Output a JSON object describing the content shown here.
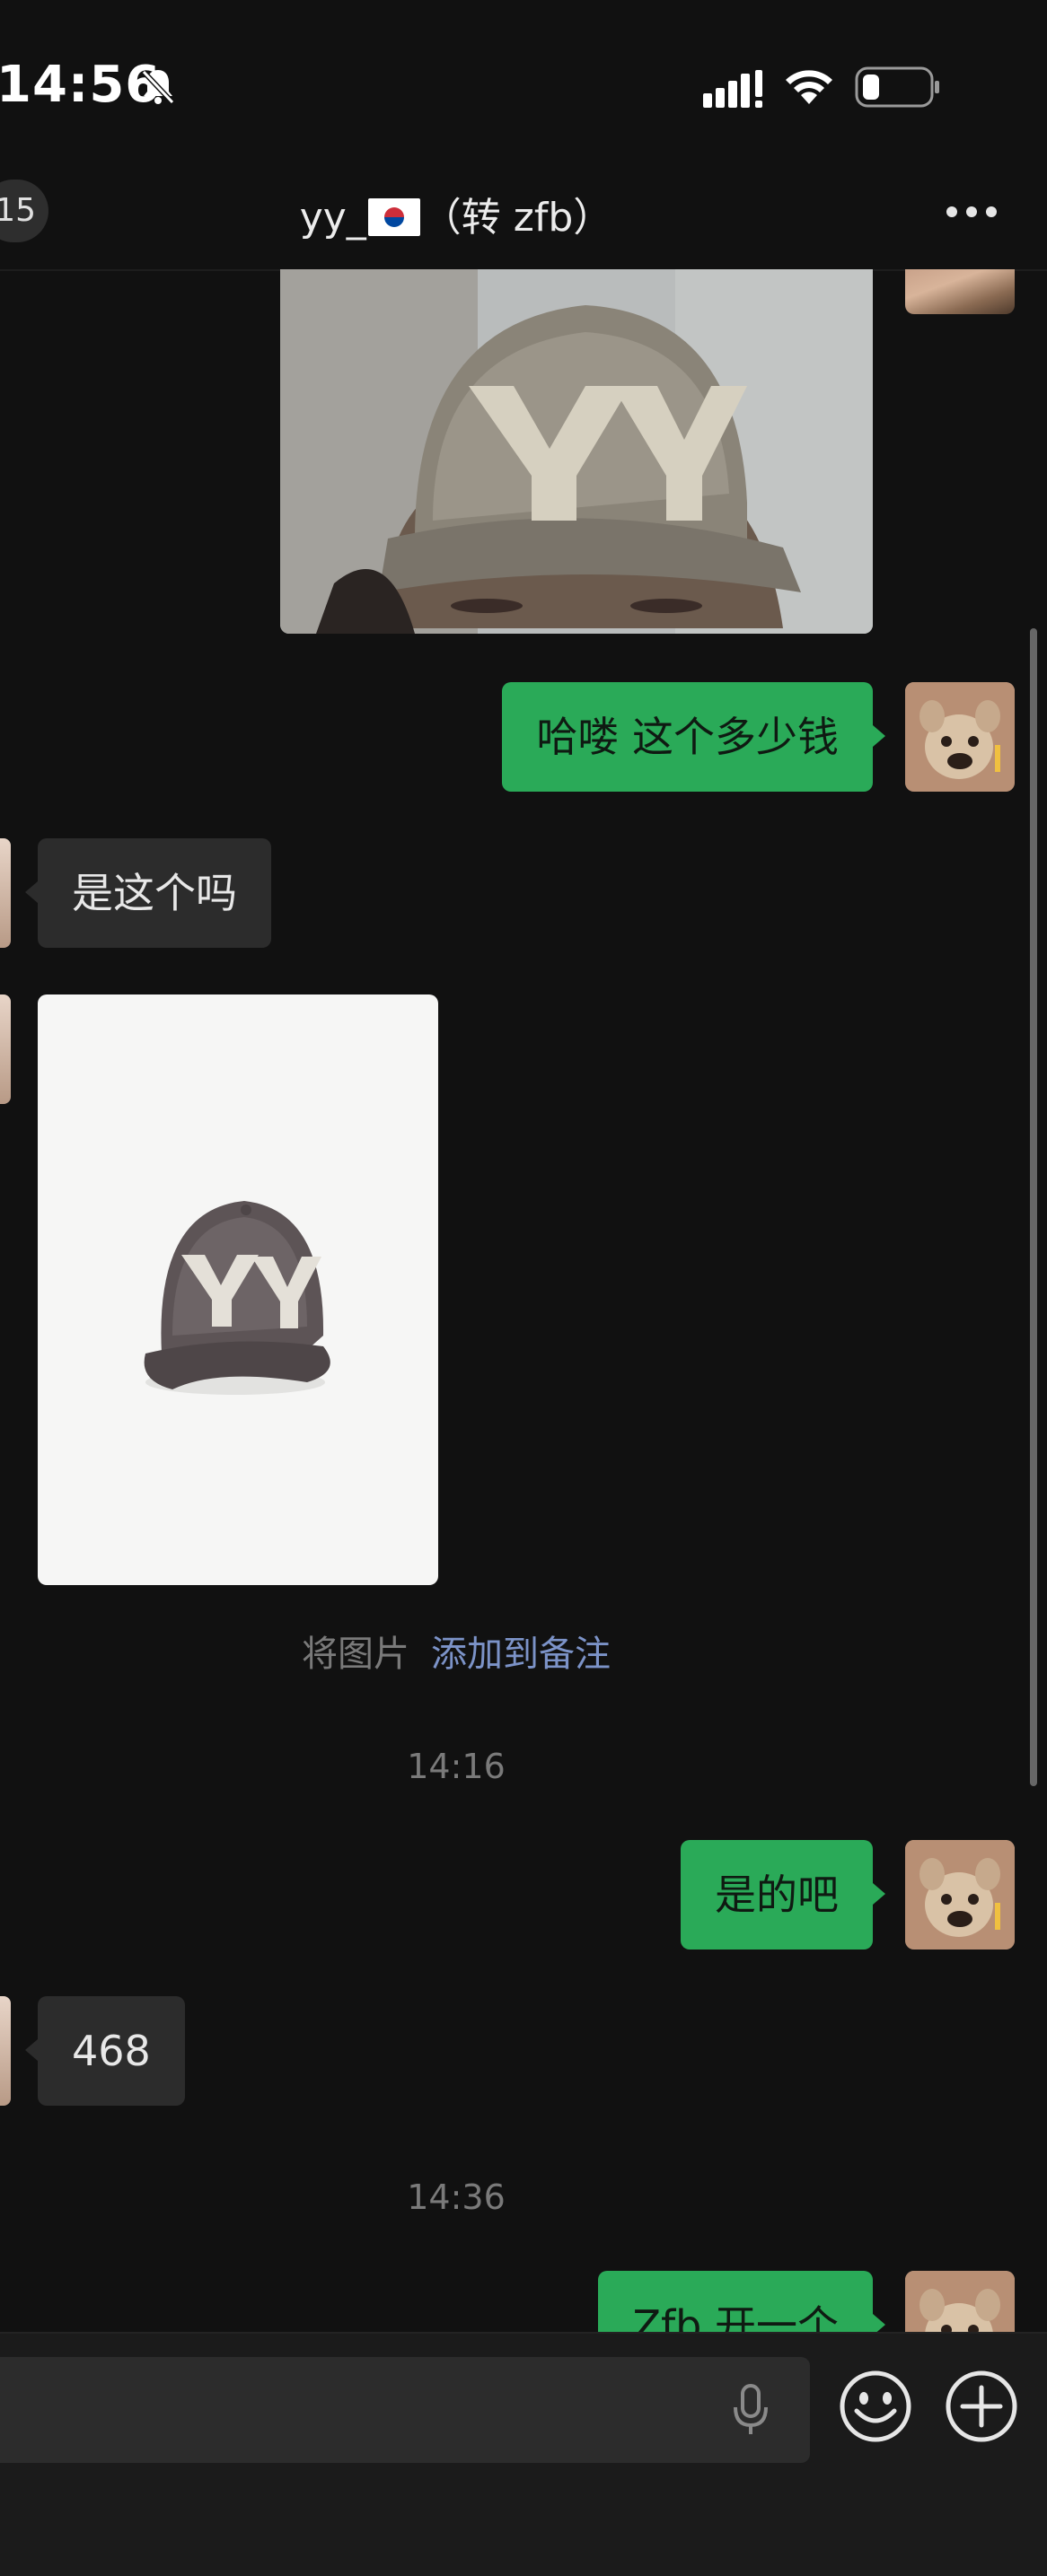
{
  "status_bar": {
    "time": "14:56",
    "icons": [
      "bell-muted-icon",
      "cellular-signal-icon",
      "wifi-icon",
      "battery-icon"
    ]
  },
  "header": {
    "back_count": "15",
    "title_prefix": "yy_",
    "title_flag": "korea-flag-icon",
    "title_suffix": "（转 zfb）",
    "more_icon": "more-dots-icon"
  },
  "messages": {
    "items": [
      {
        "type": "image",
        "from": "other",
        "content": "cap-selfie-photo"
      },
      {
        "type": "text",
        "from": "me",
        "text": "哈喽 这个多少钱"
      },
      {
        "type": "text",
        "from": "other",
        "text": "是这个吗"
      },
      {
        "type": "image",
        "from": "other",
        "content": "yy-cap-product-photo"
      },
      {
        "type": "system",
        "prefix": "将图片",
        "link": "添加到备注"
      },
      {
        "type": "timestamp",
        "text": "14:16"
      },
      {
        "type": "text",
        "from": "me",
        "text": "是的吧"
      },
      {
        "type": "text",
        "from": "other",
        "text": "468"
      },
      {
        "type": "timestamp",
        "text": "14:36"
      },
      {
        "type": "text",
        "from": "me",
        "text": "Zfb 开一个"
      }
    ]
  },
  "input_bar": {
    "placeholder": "",
    "icons": [
      "microphone-icon",
      "emoji-icon",
      "plus-icon"
    ]
  },
  "colors": {
    "background": "#111111",
    "outgoing_bubble": "#2aaa58",
    "incoming_bubble": "#2c2c2c",
    "link": "#7c93c8",
    "timestamp": "#7a7a7a"
  }
}
